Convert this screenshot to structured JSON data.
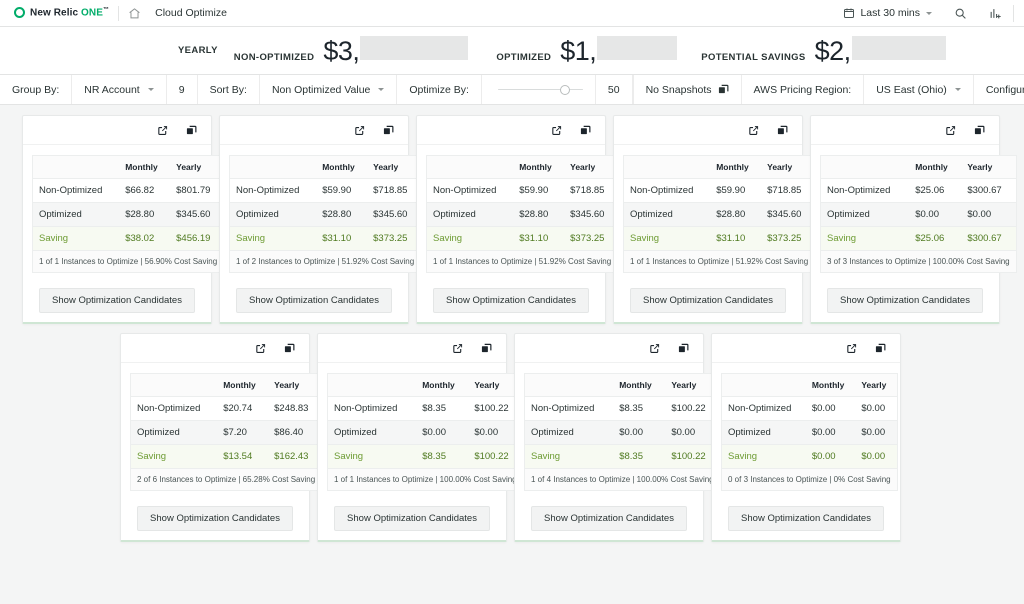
{
  "topnav": {
    "brand_name": "New Relic",
    "brand_one": "ONE",
    "brand_tm": "™",
    "home_icon": "home-icon",
    "breadcrumb": "Cloud Optimize",
    "time_picker": {
      "icon": "calendar-icon",
      "label": "Last 30 mins"
    },
    "search_icon": "search-icon",
    "chart_icon": "add-to-dashboard-icon"
  },
  "summary": {
    "period_label": "YEARLY",
    "items": [
      {
        "label": "NON-OPTIMIZED",
        "value": "$3,",
        "redacted": true
      },
      {
        "label": "OPTIMIZED",
        "value": "$1,",
        "redacted": true
      },
      {
        "label": "POTENTIAL SAVINGS",
        "value": "$2,",
        "redacted": true
      }
    ]
  },
  "filterbar": {
    "group_by_label": "Group By:",
    "group_by_value": "NR Account",
    "group_by_count": "9",
    "sort_by_label": "Sort By:",
    "sort_by_value": "Non Optimized Value",
    "optimize_by_label": "Optimize By:",
    "optimize_by_value": "50",
    "snapshots_label": "No Snapshots",
    "snapshots_icon": "stack-icon",
    "region_label": "AWS Pricing Region:",
    "region_value": "US East (Ohio)",
    "configuration_label": "Configuration",
    "configuration_icon": "gear-icon"
  },
  "card_common": {
    "col_blank": "",
    "col_monthly": "Monthly",
    "col_yearly": "Yearly",
    "row_non_optimized": "Non-Optimized",
    "row_optimized": "Optimized",
    "row_saving": "Saving",
    "button_label": "Show Optimization Candidates",
    "open_icon": "external-link-icon",
    "copy_icon": "stack-icon"
  },
  "cards": [
    {
      "title": "",
      "non_optimized": {
        "monthly": "$66.82",
        "yearly": "$801.79"
      },
      "optimized": {
        "monthly": "$28.80",
        "yearly": "$345.60"
      },
      "saving": {
        "monthly": "$38.02",
        "yearly": "$456.19"
      },
      "footer": "1 of 1 Instances to Optimize | 56.90% Cost Saving"
    },
    {
      "title": "",
      "non_optimized": {
        "monthly": "$59.90",
        "yearly": "$718.85"
      },
      "optimized": {
        "monthly": "$28.80",
        "yearly": "$345.60"
      },
      "saving": {
        "monthly": "$31.10",
        "yearly": "$373.25"
      },
      "footer": "1 of 2 Instances to Optimize | 51.92% Cost Saving"
    },
    {
      "title": "",
      "non_optimized": {
        "monthly": "$59.90",
        "yearly": "$718.85"
      },
      "optimized": {
        "monthly": "$28.80",
        "yearly": "$345.60"
      },
      "saving": {
        "monthly": "$31.10",
        "yearly": "$373.25"
      },
      "footer": "1 of 1 Instances to Optimize | 51.92% Cost Saving"
    },
    {
      "title": "",
      "non_optimized": {
        "monthly": "$59.90",
        "yearly": "$718.85"
      },
      "optimized": {
        "monthly": "$28.80",
        "yearly": "$345.60"
      },
      "saving": {
        "monthly": "$31.10",
        "yearly": "$373.25"
      },
      "footer": "1 of 1 Instances to Optimize | 51.92% Cost Saving"
    },
    {
      "title": "",
      "non_optimized": {
        "monthly": "$25.06",
        "yearly": "$300.67"
      },
      "optimized": {
        "monthly": "$0.00",
        "yearly": "$0.00"
      },
      "saving": {
        "monthly": "$25.06",
        "yearly": "$300.67"
      },
      "footer": "3 of 3 Instances to Optimize | 100.00% Cost Saving"
    },
    {
      "title": "",
      "non_optimized": {
        "monthly": "$20.74",
        "yearly": "$248.83"
      },
      "optimized": {
        "monthly": "$7.20",
        "yearly": "$86.40"
      },
      "saving": {
        "monthly": "$13.54",
        "yearly": "$162.43"
      },
      "footer": "2 of 6 Instances to Optimize | 65.28% Cost Saving"
    },
    {
      "title": "",
      "non_optimized": {
        "monthly": "$8.35",
        "yearly": "$100.22"
      },
      "optimized": {
        "monthly": "$0.00",
        "yearly": "$0.00"
      },
      "saving": {
        "monthly": "$8.35",
        "yearly": "$100.22"
      },
      "footer": "1 of 1 Instances to Optimize | 100.00% Cost Saving"
    },
    {
      "title": "",
      "non_optimized": {
        "monthly": "$8.35",
        "yearly": "$100.22"
      },
      "optimized": {
        "monthly": "$0.00",
        "yearly": "$0.00"
      },
      "saving": {
        "monthly": "$8.35",
        "yearly": "$100.22"
      },
      "footer": "1 of 4 Instances to Optimize | 100.00% Cost Saving"
    },
    {
      "title": "",
      "non_optimized": {
        "monthly": "$0.00",
        "yearly": "$0.00"
      },
      "optimized": {
        "monthly": "$0.00",
        "yearly": "$0.00"
      },
      "saving": {
        "monthly": "$0.00",
        "yearly": "$0.00"
      },
      "footer": "0 of 3 Instances to Optimize | 0% Cost Saving"
    }
  ],
  "colors": {
    "brand_green": "#00ac69",
    "saving_text": "#6d9b33",
    "card_accent": "#cfe6d4"
  }
}
